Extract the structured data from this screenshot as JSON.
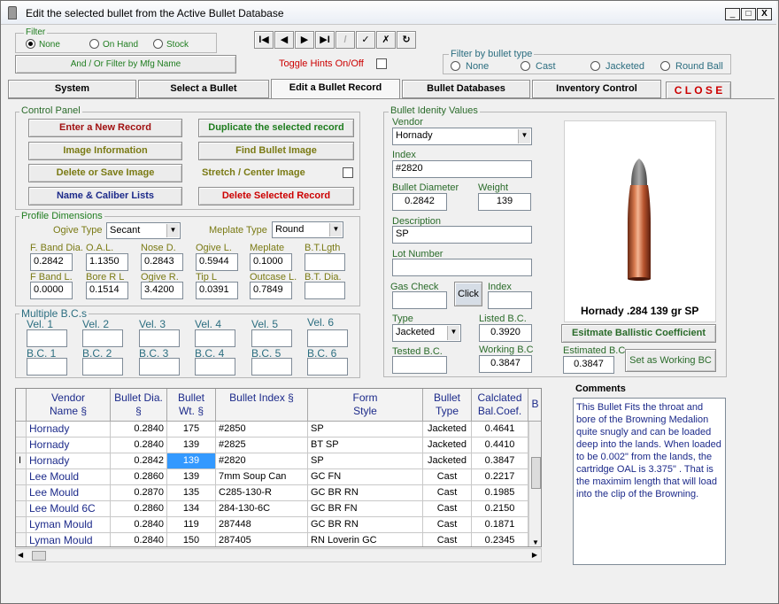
{
  "window": {
    "title": "Edit the selected bullet from the Active Bullet Database",
    "min": "_",
    "max": "□",
    "close": "X"
  },
  "filter": {
    "label": "Filter",
    "options": [
      "None",
      "On Hand",
      "Stock"
    ],
    "and_or_button": "And / Or Filter by Mfg Name"
  },
  "nav": {
    "first": "I◀",
    "prev": "◀",
    "next": "▶",
    "last": "▶I",
    "edit": "/",
    "save": "✓",
    "cancel": "✗",
    "refresh": "↻"
  },
  "toggle_hints": "Toggle Hints On/Off",
  "type_filter": {
    "label": "Filter by bullet type",
    "options": [
      "None",
      "Cast",
      "Jacketed",
      "Round Ball"
    ]
  },
  "tabs": [
    "System",
    "Select a Bullet",
    "Edit a Bullet Record",
    "Bullet Databases",
    "Inventory Control"
  ],
  "close_button": "C L O S E",
  "control_panel": {
    "label": "Control Panel",
    "enter_new": "Enter a New Record",
    "duplicate": "Duplicate the selected record",
    "image_info": "Image Information",
    "find_image": "Find Bullet Image",
    "delete_save_image": "Delete or Save Image",
    "stretch_center": "Stretch / Center Image",
    "name_caliber": "Name & Caliber Lists",
    "delete_record": "Delete Selected Record"
  },
  "profile": {
    "label": "Profile Dimensions",
    "ogive_type_label": "Ogive Type",
    "ogive_type": "Secant",
    "meplate_type_label": "Meplate Type",
    "meplate_type": "Round",
    "row1_labels": [
      "F. Band Dia.",
      "O.A.L.",
      "Nose D.",
      "Ogive L.",
      "Meplate",
      "B.T.Lgth"
    ],
    "row1_values": [
      "0.2842",
      "1.1350",
      "0.2843",
      "0.5944",
      "0.1000",
      ""
    ],
    "row2_labels": [
      "F Band L.",
      "Bore R L",
      "Ogive R.",
      "Tip L",
      "Outcase L.",
      "B.T. Dia."
    ],
    "row2_values": [
      "0.0000",
      "0.1514",
      "3.4200",
      "0.0391",
      "0.7849",
      ""
    ]
  },
  "multiple_bc": {
    "label": "Multiple B.C.s",
    "vel_labels": [
      "Vel. 1",
      "Vel. 2",
      "Vel. 3",
      "Vel. 4",
      "Vel. 5",
      "Vel. 6"
    ],
    "bc_labels": [
      "B.C. 1",
      "B.C. 2",
      "B.C. 3",
      "B.C. 4",
      "B.C. 5",
      "B.C. 6"
    ]
  },
  "identity": {
    "label": "Bullet Idenity Values",
    "vendor_label": "Vendor",
    "vendor": "Hornady",
    "index_label": "Index",
    "index": "#2820",
    "diameter_label": "Bullet Diameter",
    "diameter": "0.2842",
    "weight_label": "Weight",
    "weight": "139",
    "description_label": "Description",
    "description": "SP",
    "lot_label": "Lot Number",
    "lot": "",
    "gas_check_label": "Gas Check",
    "click_button": "Click",
    "index2_label": "Index",
    "type_label": "Type",
    "type": "Jacketed",
    "listed_bc_label": "Listed B.C.",
    "listed_bc": "0.3920",
    "tested_bc_label": "Tested B.C.",
    "working_bc_label": "Working B.C",
    "working_bc": "0.3847",
    "estimated_bc_label": "Estimated B.C.",
    "estimated_bc": "0.3847",
    "set_working_bc": "Set as Working BC",
    "estimate_button": "Esitmate Ballistic Coefficient",
    "caption": "Hornady .284 139 gr SP"
  },
  "grid": {
    "headers": [
      "Vendor Name §",
      "Bullet Dia. §",
      "Bullet Wt. §",
      "Bullet Index §",
      "Form Style",
      "Bullet Type",
      "Calclated Bal.Coef.",
      "B"
    ],
    "rows": [
      [
        "Hornady",
        "0.2840",
        "175",
        "#2850",
        "SP",
        "Jacketed",
        "0.4641"
      ],
      [
        "Hornady",
        "0.2840",
        "139",
        "#2825",
        "BT SP",
        "Jacketed",
        "0.4410"
      ],
      [
        "Hornady",
        "0.2842",
        "139",
        "#2820",
        "SP",
        "Jacketed",
        "0.3847"
      ],
      [
        "Lee Mould",
        "0.2860",
        "139",
        "7mm Soup Can",
        "GC FN",
        "Cast",
        "0.2217"
      ],
      [
        "Lee Mould",
        "0.2870",
        "135",
        "C285-130-R",
        "GC BR RN",
        "Cast",
        "0.1985"
      ],
      [
        "Lee Mould 6C",
        "0.2860",
        "134",
        "284-130-6C",
        "GC BR FN",
        "Cast",
        "0.2150"
      ],
      [
        "Lyman Mould",
        "0.2840",
        "119",
        "287448",
        "GC BR RN",
        "Cast",
        "0.1871"
      ],
      [
        "Lyman Mould",
        "0.2840",
        "150",
        "287405",
        "RN Loverin GC",
        "Cast",
        "0.2345"
      ]
    ]
  },
  "comments": {
    "label": "Comments",
    "text": "This Bullet Fits the throat and bore of the Browning Medalion quite snugly and can be loaded deep into the lands.  When loaded to be 0.002\" from the lands, the cartridge OAL is 3.375\" . That is the maximim length that will load into the clip of the Browning."
  }
}
